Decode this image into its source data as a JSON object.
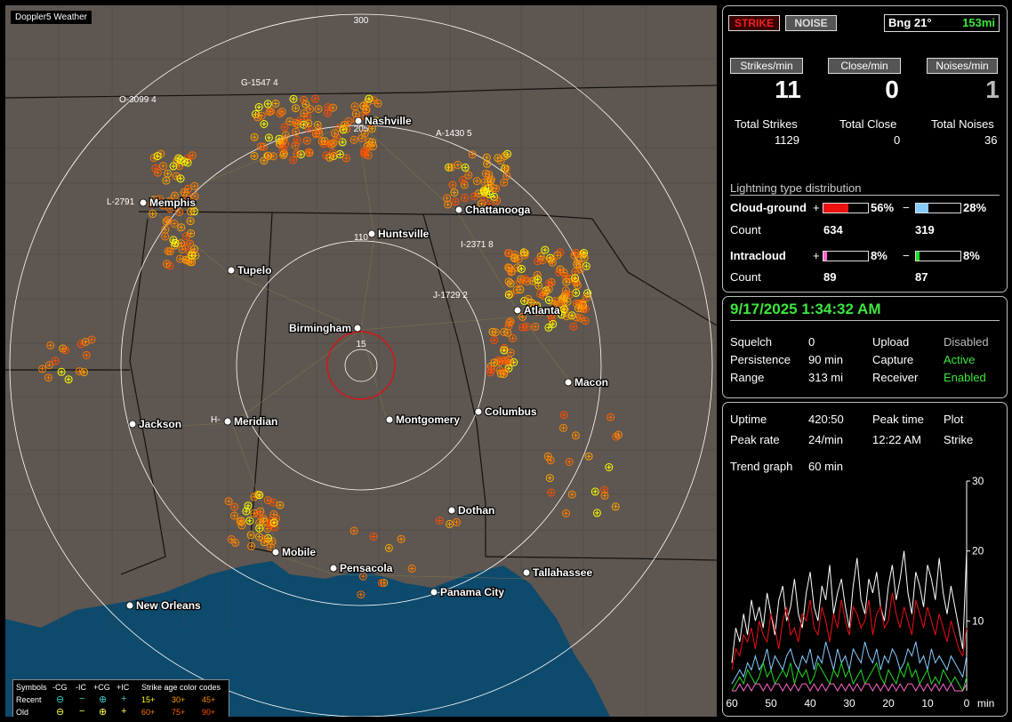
{
  "app": {
    "title": "Doppler5 Weather"
  },
  "map": {
    "range_rings": [
      "300",
      "205",
      "110",
      "15"
    ],
    "cities": [
      {
        "name": "Nashville"
      },
      {
        "name": "Chattanooga"
      },
      {
        "name": "Memphis"
      },
      {
        "name": "Huntsville"
      },
      {
        "name": "Tupelo"
      },
      {
        "name": "Atlanta"
      },
      {
        "name": "Birmingham"
      },
      {
        "name": "Macon"
      },
      {
        "name": "Jackson"
      },
      {
        "name": "Meridian"
      },
      {
        "name": "Montgomery"
      },
      {
        "name": "Columbus"
      },
      {
        "name": "Dothan"
      },
      {
        "name": "Mobile"
      },
      {
        "name": "Pensacola"
      },
      {
        "name": "Tallahassee"
      },
      {
        "name": "Panama City"
      },
      {
        "name": "New Orleans"
      }
    ],
    "storm_labels": [
      "G-1547 4",
      "O-3099 4",
      "A-1430 5",
      "L-2791",
      "I-2371 8",
      "J-1729 2",
      "H-"
    ]
  },
  "legend": {
    "symbols_label": "Symbols",
    "cols": [
      "-CG",
      "-IC",
      "+CG",
      "+IC"
    ],
    "age_title": "Strike age color codes",
    "recent_label": "Recent",
    "old_label": "Old",
    "ages_recent": [
      "15+",
      "30+",
      "45+"
    ],
    "ages_old": [
      "60+",
      "75+",
      "90+"
    ],
    "age_colors": [
      "#ffff00",
      "#ffa500",
      "#ff8c00",
      "#ff7f00",
      "#ff6a00",
      "#ff5000"
    ]
  },
  "top": {
    "strike_button": "STRIKE",
    "noise_button": "NOISE",
    "bearing": "Bng 21°",
    "distance": "153mi"
  },
  "rates": {
    "strikes_label": "Strikes/min",
    "strikes_value": "11",
    "close_label": "Close/min",
    "close_value": "0",
    "noises_label": "Noises/min",
    "noises_value": "1",
    "total_strikes_label": "Total Strikes",
    "total_strikes": "1129",
    "total_close_label": "Total Close",
    "total_close": "0",
    "total_noises_label": "Total Noises",
    "total_noises": "36"
  },
  "distribution": {
    "title": "Lightning type distribution",
    "cg_label": "Cloud-ground",
    "ic_label": "Intracloud",
    "count_label": "Count",
    "plus": "+",
    "minus": "−",
    "cg_pos_pct": "56%",
    "cg_pos_frac": 0.56,
    "cg_pos_count": "634",
    "cg_neg_pct": "28%",
    "cg_neg_frac": 0.28,
    "cg_neg_count": "319",
    "ic_pos_pct": "8%",
    "ic_pos_frac": 0.08,
    "ic_pos_count": "89",
    "ic_neg_pct": "8%",
    "ic_neg_frac": 0.08,
    "ic_neg_count": "87",
    "colors": {
      "cg_pos": "#ee1111",
      "cg_neg": "#88ccff",
      "ic_pos": "#ff66cc",
      "ic_neg": "#22dd22"
    }
  },
  "status": {
    "datetime": "9/17/2025 1:34:32 AM",
    "squelch_label": "Squelch",
    "squelch": "0",
    "persistence_label": "Persistence",
    "persistence": "90 min",
    "range_label": "Range",
    "range": "313 mi",
    "upload_label": "Upload",
    "upload": "Disabled",
    "capture_label": "Capture",
    "capture": "Active",
    "receiver_label": "Receiver",
    "receiver": "Enabled"
  },
  "stats": {
    "uptime_label": "Uptime",
    "uptime": "420:50",
    "peak_time_label": "Peak time",
    "plot_label": "Plot",
    "peak_rate_label": "Peak rate",
    "peak_rate": "24/min",
    "peak_time": "12:22 AM",
    "plot": "Strike",
    "trend_label": "Trend graph",
    "trend_window": "60 min"
  },
  "chart_data": {
    "type": "line",
    "x_ticks": [
      "60",
      "50",
      "40",
      "30",
      "20",
      "10",
      "0"
    ],
    "x_unit": "min",
    "y_ticks": [
      "30",
      "20",
      "10"
    ],
    "ylim": [
      0,
      30
    ],
    "xlim": [
      60,
      0
    ],
    "series": [
      {
        "color": "#ffffff",
        "values": [
          4,
          9,
          7,
          11,
          8,
          13,
          10,
          12,
          9,
          14,
          11,
          8,
          13,
          15,
          10,
          12,
          16,
          11,
          9,
          14,
          17,
          12,
          10,
          15,
          13,
          18,
          11,
          14,
          16,
          12,
          9,
          15,
          19,
          13,
          11,
          16,
          14,
          17,
          12,
          10,
          15,
          18,
          13,
          16,
          20,
          14,
          11,
          17,
          15,
          12,
          18,
          16,
          13,
          19,
          14,
          11,
          15,
          12,
          9,
          6,
          20
        ]
      },
      {
        "color": "#ee1111",
        "values": [
          3,
          6,
          5,
          8,
          7,
          9,
          6,
          10,
          8,
          7,
          11,
          9,
          6,
          10,
          12,
          8,
          9,
          7,
          11,
          10,
          13,
          9,
          8,
          12,
          10,
          7,
          11,
          9,
          13,
          10,
          8,
          12,
          11,
          9,
          10,
          13,
          8,
          11,
          12,
          9,
          10,
          14,
          11,
          9,
          12,
          10,
          8,
          13,
          11,
          9,
          12,
          10,
          8,
          11,
          9,
          7,
          10,
          8,
          6,
          5,
          9
        ]
      },
      {
        "color": "#88ccff",
        "values": [
          1,
          2,
          3,
          2,
          4,
          3,
          5,
          3,
          4,
          6,
          3,
          5,
          4,
          3,
          5,
          6,
          4,
          3,
          5,
          4,
          6,
          3,
          5,
          4,
          7,
          5,
          3,
          6,
          4,
          5,
          3,
          6,
          5,
          4,
          7,
          5,
          4,
          6,
          3,
          5,
          4,
          6,
          5,
          3,
          4,
          6,
          5,
          7,
          4,
          5,
          3,
          6,
          4,
          5,
          4,
          3,
          5,
          4,
          3,
          2,
          5
        ]
      },
      {
        "color": "#22dd22",
        "values": [
          0,
          1,
          2,
          1,
          3,
          2,
          1,
          2,
          4,
          2,
          3,
          1,
          2,
          3,
          2,
          4,
          1,
          3,
          2,
          3,
          1,
          2,
          4,
          3,
          2,
          1,
          3,
          2,
          4,
          2,
          3,
          1,
          2,
          3,
          1,
          2,
          3,
          4,
          2,
          1,
          3,
          2,
          1,
          3,
          2,
          4,
          2,
          3,
          1,
          2,
          3,
          1,
          2,
          1,
          3,
          2,
          1,
          2,
          1,
          0,
          2
        ]
      },
      {
        "color": "#ff66cc",
        "values": [
          0,
          0,
          1,
          0,
          1,
          0,
          1,
          1,
          0,
          1,
          0,
          1,
          1,
          0,
          1,
          0,
          1,
          0,
          1,
          1,
          0,
          1,
          0,
          1,
          0,
          1,
          1,
          0,
          1,
          0,
          1,
          0,
          1,
          0,
          1,
          1,
          0,
          1,
          0,
          1,
          0,
          1,
          0,
          1,
          0,
          1,
          1,
          0,
          1,
          0,
          1,
          0,
          1,
          0,
          1,
          0,
          1,
          0,
          0,
          0,
          1
        ]
      }
    ]
  }
}
